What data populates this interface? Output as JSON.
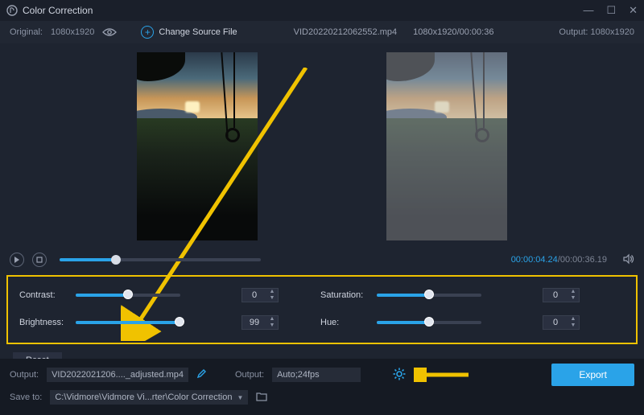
{
  "titlebar": {
    "title": "Color Correction"
  },
  "topbar": {
    "original_label": "Original:",
    "original_res": "1080x1920",
    "change_source": "Change Source File",
    "filename": "VID20220212062552.mp4",
    "file_res": "1080x1920",
    "file_dur": "00:00:36",
    "output_label": "Output:",
    "output_res": "1080x1920"
  },
  "playbar": {
    "prog_pct": 28,
    "current_time": "00:00:04.24",
    "total_time": "00:00:36.19"
  },
  "controls": {
    "contrast": {
      "label": "Contrast:",
      "pct": 50,
      "value": "0"
    },
    "brightness": {
      "label": "Brightness:",
      "pct": 99,
      "value": "99"
    },
    "saturation": {
      "label": "Saturation:",
      "pct": 50,
      "value": "0"
    },
    "hue": {
      "label": "Hue:",
      "pct": 50,
      "value": "0"
    },
    "reset": "Reset"
  },
  "bottom": {
    "output_label": "Output:",
    "output_file": "VID2022021206...._adjusted.mp4",
    "format_label": "Output:",
    "format_val": "Auto;24fps",
    "save_label": "Save to:",
    "save_path": "C:\\Vidmore\\Vidmore Vi...rter\\Color Correction",
    "export": "Export"
  }
}
